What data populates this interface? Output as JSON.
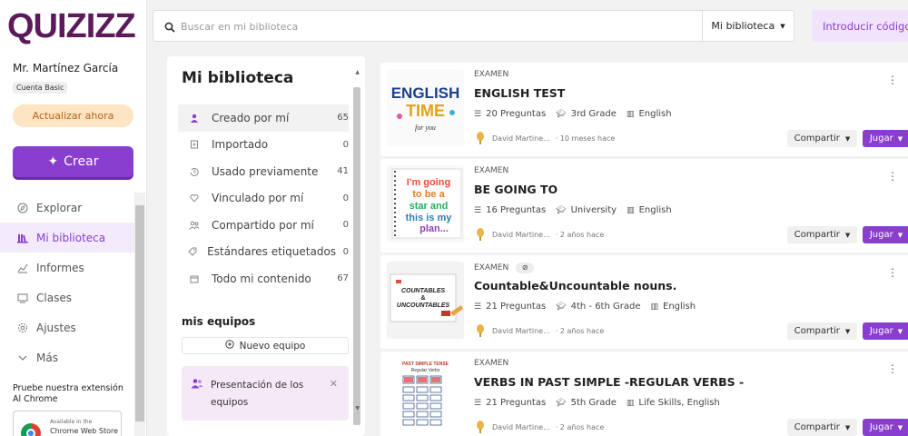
{
  "app": {
    "logo": "QUIZIZZ"
  },
  "sidebar": {
    "user_name": "Mr. Martínez García",
    "account_type": "Cuenta Basic",
    "upgrade_label": "Actualizar ahora",
    "create_label": "Crear",
    "nav": [
      {
        "label": "Explorar",
        "icon": "compass-icon"
      },
      {
        "label": "Mi biblioteca",
        "icon": "library-icon",
        "active": true
      },
      {
        "label": "Informes",
        "icon": "reports-icon"
      },
      {
        "label": "Clases",
        "icon": "classes-icon"
      },
      {
        "label": "Ajustes",
        "icon": "settings-icon"
      },
      {
        "label": "Más",
        "icon": "chevron-down-icon"
      }
    ],
    "extension_text": "Pruebe nuestra extensión Al Chrome",
    "store_small": "Available in the",
    "store_name": "Chrome Web Store"
  },
  "topbar": {
    "search_placeholder": "Buscar en mi biblioteca",
    "scope_label": "Mi biblioteca",
    "code_button": "Introducir código"
  },
  "library": {
    "title": "Mi biblioteca",
    "filters": [
      {
        "label": "Creado por mí",
        "count": "65",
        "icon": "user-icon",
        "active": true
      },
      {
        "label": "Importado",
        "count": "0",
        "icon": "import-icon"
      },
      {
        "label": "Usado previamente",
        "count": "41",
        "icon": "history-icon"
      },
      {
        "label": "Vinculado por mí",
        "count": "0",
        "icon": "heart-icon"
      },
      {
        "label": "Compartido por mí",
        "count": "0",
        "icon": "shared-icon"
      },
      {
        "label": "Estándares etiquetados",
        "count": "0",
        "icon": "tag-icon"
      },
      {
        "label": "Todo mi contenido",
        "count": "67",
        "icon": "folder-icon"
      }
    ],
    "teams_title": "mis equipos",
    "new_team_label": "Nuevo equipo",
    "team_card_text": "Presentación de los equipos"
  },
  "quizzes": [
    {
      "type": "EXAMEN",
      "title": "ENGLISH TEST",
      "questions": "20 Preguntas",
      "grade": "3rd Grade",
      "subject": "English",
      "author": "David Martine...",
      "time": "· 10 meses hace",
      "thumb_text": [
        "ENGLISH",
        "TIME",
        "for you"
      ],
      "hidden": false
    },
    {
      "type": "EXAMEN",
      "title": "BE GOING TO",
      "questions": "16 Preguntas",
      "grade": "University",
      "subject": "English",
      "author": "David Martine...",
      "time": "· 2 años hace",
      "thumb_text": [
        "I'm going",
        "to be a",
        "star and",
        "this is my",
        "plan..."
      ],
      "hidden": false
    },
    {
      "type": "EXAMEN",
      "title": "Countable&Uncountable nouns.",
      "questions": "21 Preguntas",
      "grade": "4th - 6th Grade",
      "subject": "English",
      "author": "David Martine...",
      "time": "· 2 años hace",
      "thumb_text": [
        "COUNTABLES",
        "&",
        "UNCOUNTABLES"
      ],
      "hidden": true
    },
    {
      "type": "EXAMEN",
      "title": "VERBS IN PAST SIMPLE -REGULAR VERBS -",
      "questions": "21 Preguntas",
      "grade": "5th Grade",
      "subject": "Life Skills, English",
      "author": "David Martine...",
      "time": "· 2 años hace",
      "thumb_text": [
        "PAST SIMPLE TENSE",
        "Regular Verbs"
      ],
      "hidden": false
    }
  ],
  "actions": {
    "share_label": "Compartir",
    "play_label": "Jugar"
  },
  "colors": {
    "brand": "#5c1a5b",
    "accent": "#8a3ecf",
    "upgrade_bg": "#fde4c2"
  }
}
